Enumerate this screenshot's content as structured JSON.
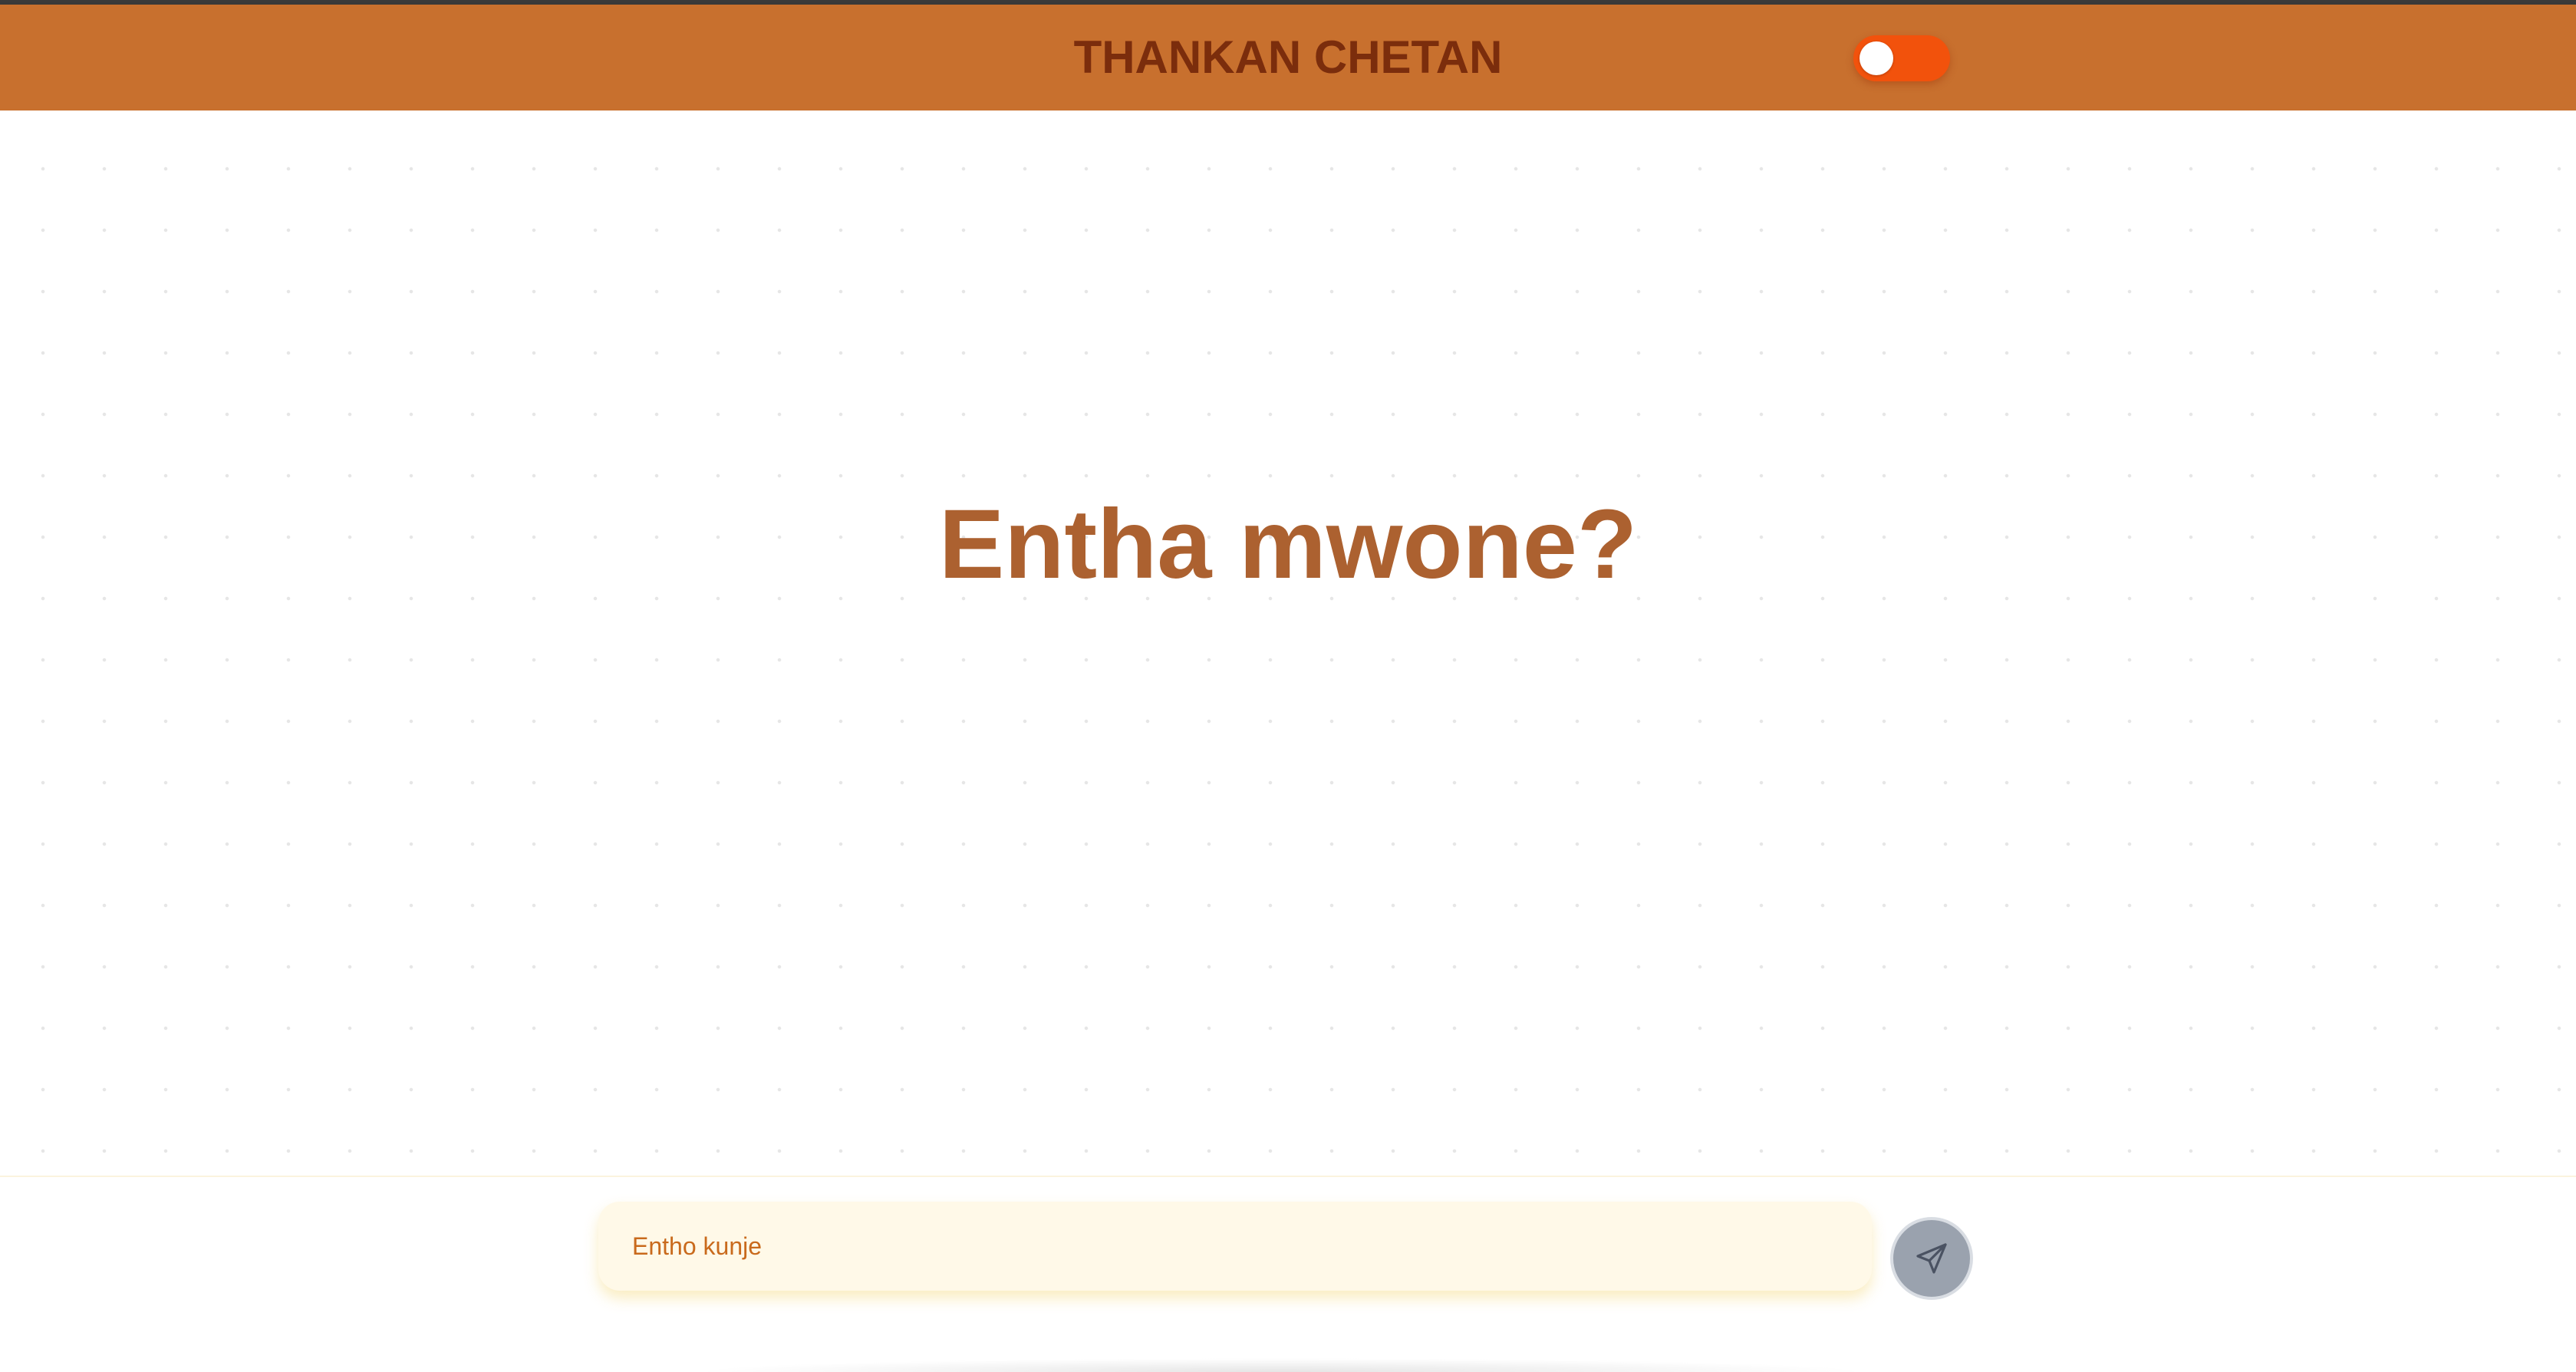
{
  "header": {
    "title": "THANKAN CHETAN",
    "toggle": {
      "state": "off",
      "track_color": "#f2520c",
      "knob_position": "left"
    },
    "background_color": "#c8702e"
  },
  "main": {
    "greeting": "Entha mwone?"
  },
  "composer": {
    "input_value": "",
    "input_placeholder": "Entho kunje",
    "send_icon": "send-paper-plane-icon"
  },
  "colors": {
    "accent": "#c8702e",
    "greeting_text": "#ac6130",
    "title_text": "#7b2d0c",
    "input_background": "#fff9e8",
    "send_button": "#9aa2ae"
  }
}
